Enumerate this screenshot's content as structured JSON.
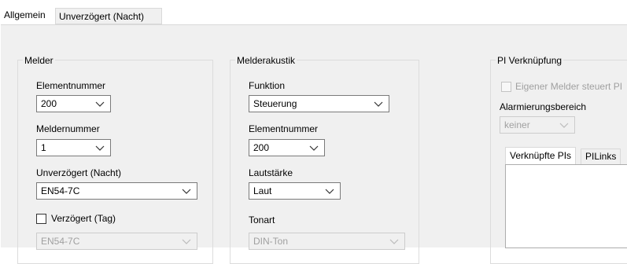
{
  "tabs": {
    "general": "Allgemein",
    "night": "Unverzögert (Nacht)"
  },
  "melder": {
    "group_title": "Melder",
    "element_number_label": "Elementnummer",
    "element_number_value": "200",
    "detector_number_label": "Meldernummer",
    "detector_number_value": "1",
    "unverzoegert_label": "Unverzögert (Nacht)",
    "unverzoegert_value": "EN54-7C",
    "verzoegert_label": "Verzögert (Tag)",
    "verzoegert_checked": false,
    "verzoegert_value": "EN54-7C"
  },
  "akustik": {
    "group_title": "Melderakustik",
    "function_label": "Funktion",
    "function_value": "Steuerung",
    "element_number_label": "Elementnummer",
    "element_number_value": "200",
    "volume_label": "Lautstärke",
    "volume_value": "Laut",
    "tone_label": "Tonart",
    "tone_value": "DIN-Ton"
  },
  "pi": {
    "group_title": "PI Verknüpfung",
    "own_detector_label": "Eigener Melder steuert PI",
    "own_detector_checked": false,
    "alarm_area_label": "Alarmierungsbereich",
    "alarm_area_value": "keiner",
    "tab_linked": "Verknüpfte PIs",
    "tab_links": "PILinks"
  },
  "icons": {
    "dropdown": "chevron-down-icon"
  }
}
